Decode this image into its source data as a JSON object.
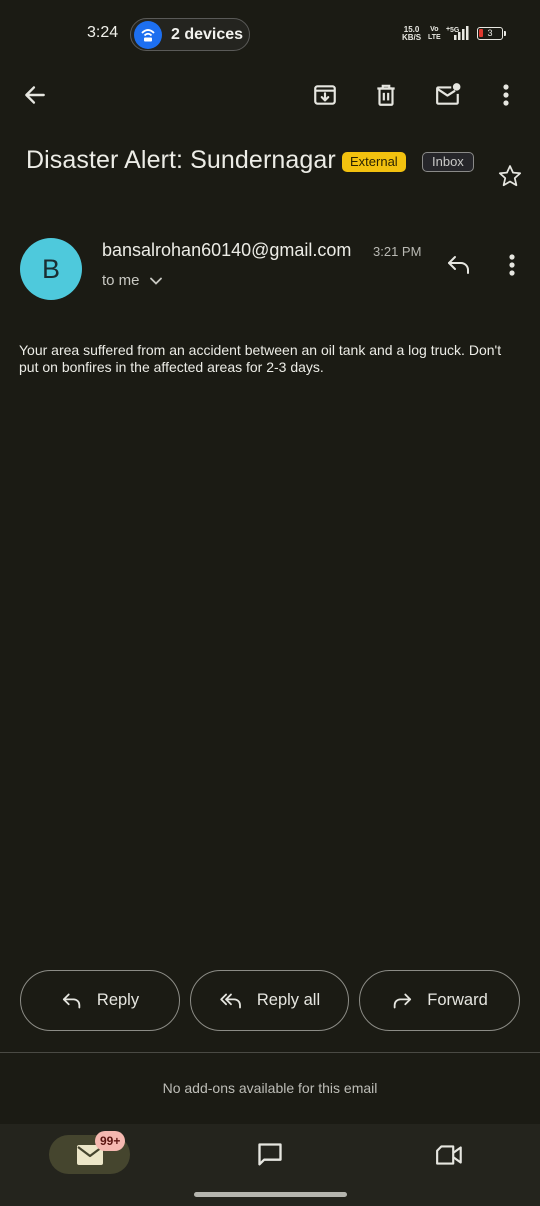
{
  "status_bar": {
    "time": "3:24",
    "devices_label": "2 devices",
    "net_speed_value": "15.0",
    "net_speed_unit": "KB/S",
    "volte_top": "Vo",
    "volte_bottom": "LTE",
    "network_type": "5G",
    "battery_level": "3"
  },
  "toolbar": {
    "icons": [
      "back-arrow-icon",
      "archive-icon",
      "delete-icon",
      "mark-unread-icon",
      "more-vert-icon"
    ]
  },
  "email": {
    "subject": "Disaster Alert: Sundernagar",
    "label_external": "External",
    "label_inbox": "Inbox",
    "avatar_initial": "B",
    "sender": "bansalrohan60140@gmail.com",
    "time": "3:21 PM",
    "recipient": "to me",
    "body": "Your area suffered from an accident between an oil tank and a log truck. Don't put on bonfires in the affected areas for 2-3 days."
  },
  "actions": {
    "reply": "Reply",
    "reply_all": "Reply all",
    "forward": "Forward"
  },
  "addons_text": "No add-ons available for this email",
  "bottom_nav": {
    "mail_badge": "99+",
    "items": [
      "mail-icon",
      "chat-icon",
      "meet-icon"
    ]
  },
  "colors": {
    "background": "#1b1b14",
    "external_chip": "#f2c10f",
    "avatar": "#4ec9dc",
    "badge": "#f5b8b0"
  }
}
